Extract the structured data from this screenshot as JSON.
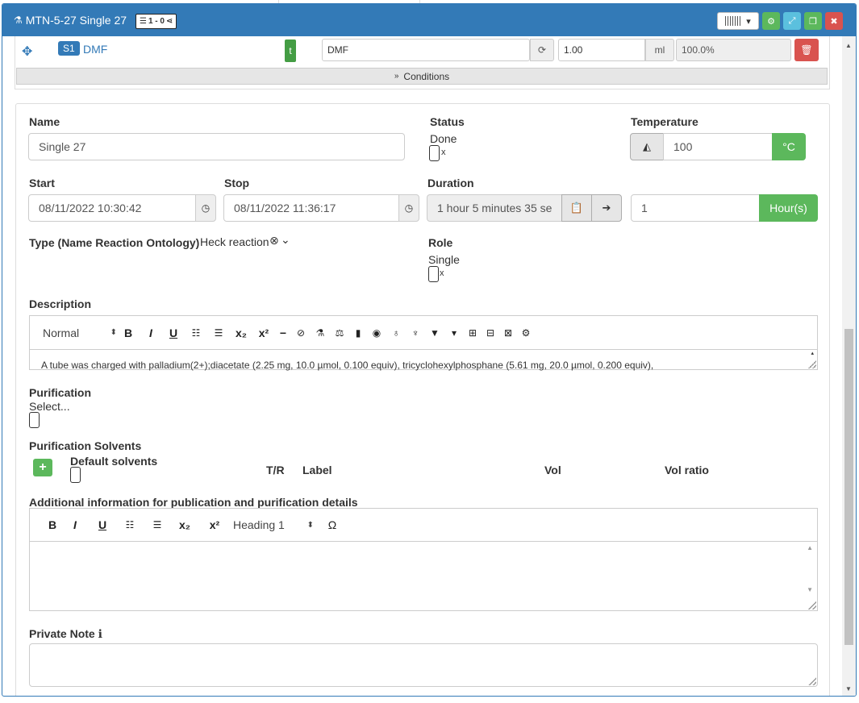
{
  "header": {
    "title": "MTN-5-27 Single 27",
    "count_badge": "1 - 0"
  },
  "solvent": {
    "badge": "S1",
    "name": "DMF",
    "t_label": "t",
    "label_value": "DMF",
    "amount": "1.00",
    "unit": "ml",
    "ratio": "100.0%",
    "conditions_label": "Conditions"
  },
  "properties": {
    "name_label": "Name",
    "name_value": "Single 27",
    "status_label": "Status",
    "status_value": "Done",
    "temperature_label": "Temperature",
    "temperature_value": "100",
    "temperature_unit": "°C",
    "start_label": "Start",
    "start_value": "08/11/2022 10:30:42",
    "stop_label": "Stop",
    "stop_value": "08/11/2022 11:36:17",
    "duration_label": "Duration",
    "duration_value": "1 hour 5 minutes 35 se",
    "duration_number": "1",
    "duration_unit": "Hour(s)",
    "type_label": "Type (Name Reaction Ontology)",
    "type_value": "Heck reaction",
    "role_label": "Role",
    "role_value": "Single",
    "description_label": "Description",
    "description_format": "Normal",
    "description_text": "A tube was charged with palladium(2+);diacetate (2.25 mg, 10.0 µmol, 0.100 equiv), tricyclohexylphosphane (5.61 mg, 20.0 µmol, 0.200 equiv),",
    "purification_label": "Purification",
    "purification_value": "Select...",
    "purification_solvents_label": "Purification Solvents",
    "default_solvents_label": "Default solvents",
    "col_tr": "T/R",
    "col_label": "Label",
    "col_vol": "Vol",
    "col_vol_ratio": "Vol ratio",
    "additional_label": "Additional information for publication and purification details",
    "heading_select": "Heading 1",
    "private_note_label": "Private Note"
  },
  "colors": {
    "primary": "#337ab7",
    "success": "#5cb85c",
    "danger": "#d9534f",
    "info": "#5bc0de"
  }
}
